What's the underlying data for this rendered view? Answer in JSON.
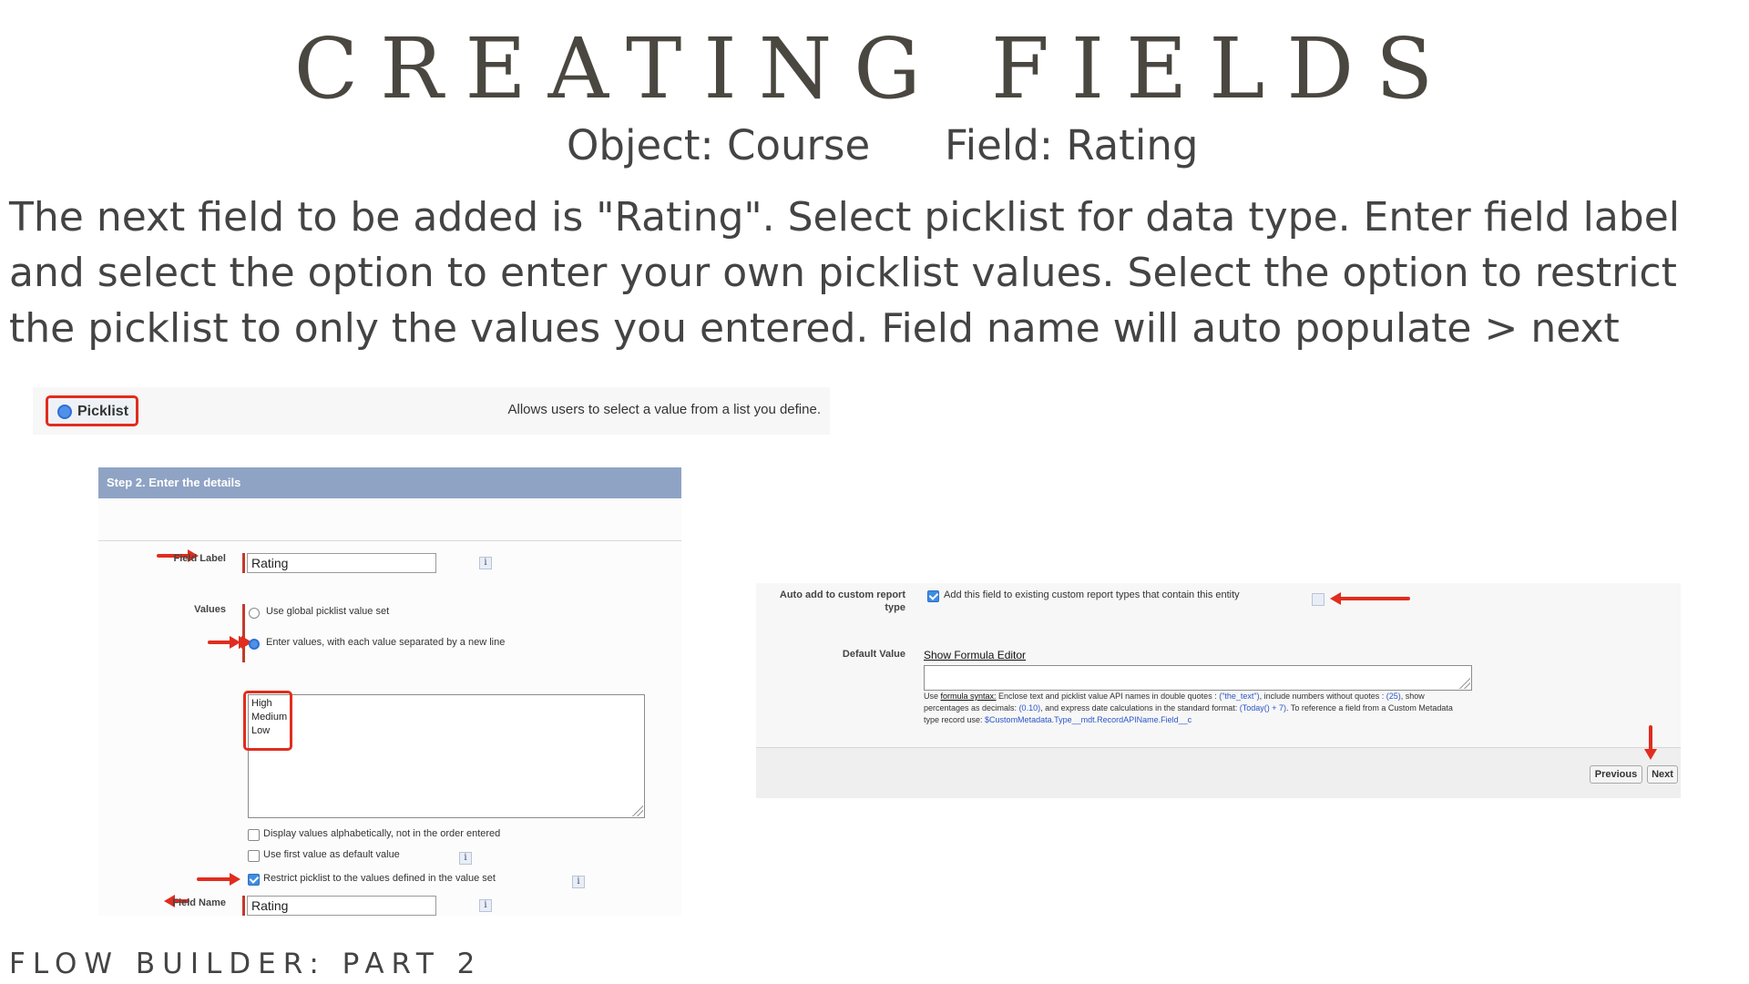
{
  "title": "CREATING FIELDS",
  "subtitle": {
    "object": "Object: Course",
    "field": "Field: Rating"
  },
  "description": "The next field to be added is \"Rating\". Select picklist for data type. Enter field label and select the option to enter your own picklist values. Select the option to restrict the picklist to only the values you entered. Field name will auto populate > next",
  "footer": "FLOW BUILDER: PART 2",
  "picklist_panel": {
    "option_label": "Picklist",
    "option_description": "Allows users to select a value from a list you define."
  },
  "step_panel": {
    "header": "Step 2. Enter the details",
    "field_label_label": "Field Label",
    "field_label_value": "Rating",
    "values_label": "Values",
    "option_global": "Use global picklist value set",
    "option_enter": "Enter values, with each value separated by a new line",
    "values": [
      "High",
      "Medium",
      "Low"
    ],
    "checkbox_alpha": "Display values alphabetically, not in the order entered",
    "checkbox_default": "Use first value as default value",
    "checkbox_restrict": "Restrict picklist to the values defined in the value set",
    "field_name_label": "Field Name",
    "field_name_value": "Rating",
    "info": "i"
  },
  "right_panel": {
    "auto_add_label_1": "Auto add to custom report",
    "auto_add_label_2": "type",
    "auto_add_checkbox": "Add this field to existing custom report types that contain this entity",
    "default_value_label": "Default Value",
    "show_formula_editor": "Show Formula Editor",
    "help": {
      "prefix": "Use ",
      "formula_syntax": "formula syntax:",
      "t1": " Enclose text and picklist value API names in double quotes : ",
      "ex_text": "(\"the_text\")",
      "t2": ", include numbers without quotes : ",
      "ex_num": "(25)",
      "t3": ", show percentages as decimals: ",
      "ex_pct": "(0.10)",
      "t4": ", and express date calculations in the standard format: ",
      "ex_date": "(Today() + 7)",
      "t5": ". To reference a field from a Custom Metadata type record use: ",
      "ex_meta": "$CustomMetadata.Type__mdt.RecordAPIName.Field__c"
    },
    "previous_button": "Previous",
    "next_button": "Next"
  }
}
